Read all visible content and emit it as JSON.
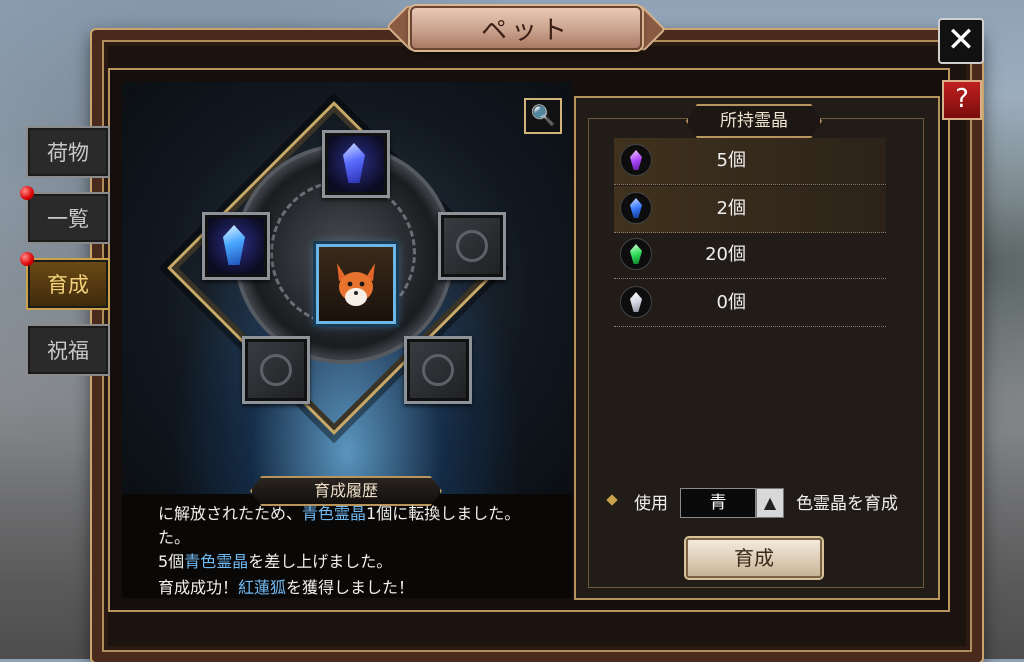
{
  "window": {
    "title": "ペット",
    "close_label": "✕",
    "help_label": "?"
  },
  "tabs": [
    {
      "label": "荷物",
      "active": false,
      "notify": false
    },
    {
      "label": "一覧",
      "active": false,
      "notify": true
    },
    {
      "label": "育成",
      "active": true,
      "notify": true
    },
    {
      "label": "祝福",
      "active": false,
      "notify": false
    }
  ],
  "enhance": {
    "zoom_icon": "magnifier-icon",
    "slots": [
      {
        "position": "top",
        "state": "blue-crystal"
      },
      {
        "position": "left",
        "state": "blue-crystal"
      },
      {
        "position": "right",
        "state": "empty"
      },
      {
        "position": "bottom-left",
        "state": "empty"
      },
      {
        "position": "bottom-right",
        "state": "empty"
      }
    ],
    "pet_icon": "red-fox-portrait"
  },
  "history": {
    "label": "育成履歴",
    "lines": [
      {
        "parts": [
          {
            "text": "に解放されたため、",
            "blue": false
          },
          {
            "text": "青色霊晶",
            "blue": true
          },
          {
            "text": "1個に転換しました。",
            "blue": false
          }
        ]
      },
      {
        "parts": [
          {
            "text": "た。",
            "blue": false
          }
        ]
      },
      {
        "parts": [
          {
            "text": "5個",
            "blue": false
          },
          {
            "text": "青色霊晶",
            "blue": true
          },
          {
            "text": "を差し上げました。",
            "blue": false
          }
        ]
      },
      {
        "parts": [
          {
            "text": "育成成功！",
            "blue": false
          },
          {
            "text": "紅蓮狐",
            "blue": true
          },
          {
            "text": "を獲得しました！",
            "blue": false
          }
        ]
      }
    ]
  },
  "owned": {
    "header": "所持霊晶",
    "crystals": [
      {
        "color_name": "purple",
        "color": "#b04bff",
        "count": "5個"
      },
      {
        "color_name": "blue",
        "color": "#3a7bff",
        "count": "2個"
      },
      {
        "color_name": "green",
        "color": "#33e05a",
        "count": "20個"
      },
      {
        "color_name": "white",
        "color": "#e8e8f0",
        "count": "0個"
      }
    ]
  },
  "controls": {
    "use_label": "使用",
    "selected_color": "青",
    "dropdown_arrow": "▲",
    "suffix": "色霊晶を育成",
    "grow_button": "育成"
  }
}
